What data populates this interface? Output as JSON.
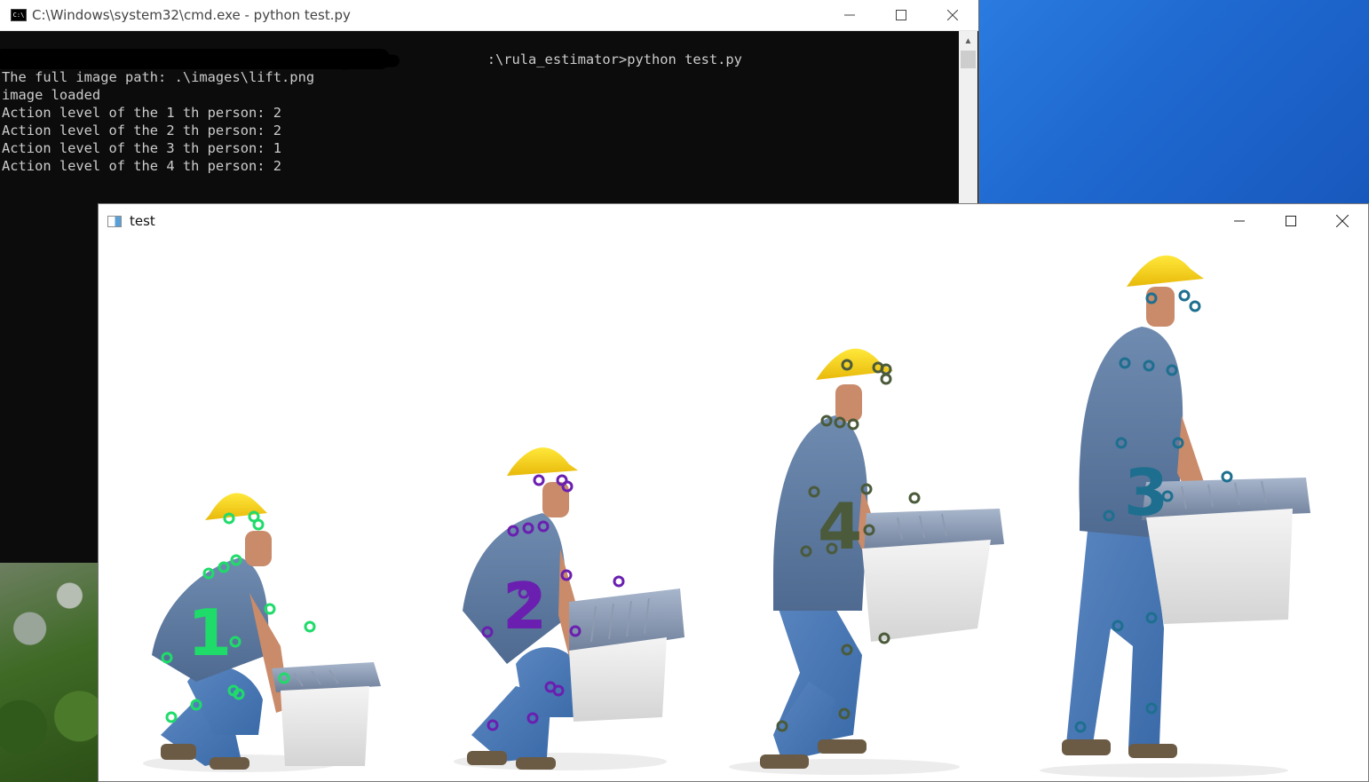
{
  "cmd_window": {
    "title": "C:\\Windows\\system32\\cmd.exe - python  test.py",
    "icon": "cmd-icon",
    "lines": [
      "[                                                          :\\rula_estimator>python test.py",
      "The full image path: .\\images\\lift.png",
      "image loaded",
      "Action level of the 1 th person: 2",
      "Action level of the 2 th person: 2",
      "Action level of the 3 th person: 1",
      "Action level of the 4 th person: 2"
    ],
    "controls": {
      "minimize": "minimize-icon",
      "maximize": "maximize-icon",
      "close": "close-icon"
    }
  },
  "test_window": {
    "title": "test",
    "icon": "image-window-icon",
    "controls": {
      "minimize": "minimize-icon",
      "maximize": "maximize-icon",
      "close": "close-icon"
    },
    "image": {
      "description_source": "lift.png",
      "people": [
        {
          "label": "1",
          "color": "#1fdb6a",
          "pose": "crouching lifting box"
        },
        {
          "label": "2",
          "color": "#6a1fb0",
          "pose": "squatting gripping box"
        },
        {
          "label": "4",
          "color": "#4a5a3a",
          "pose": "half standing with box"
        },
        {
          "label": "3",
          "color": "#1e6f8f",
          "pose": "standing carrying box"
        }
      ]
    }
  },
  "colors": {
    "desktop": "#1b63c9",
    "console_bg": "#0c0c0c",
    "console_text": "#cccccc"
  }
}
